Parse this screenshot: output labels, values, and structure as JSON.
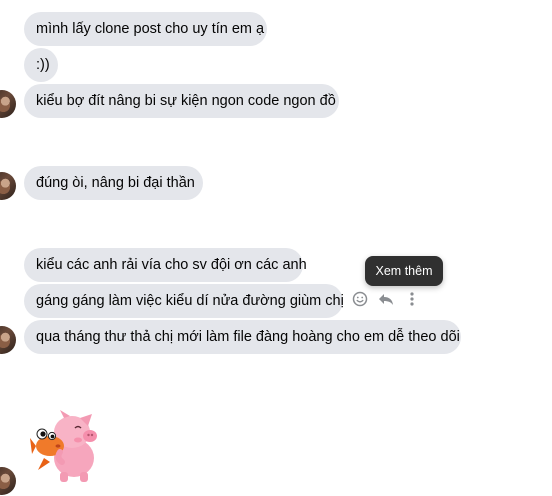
{
  "messages": [
    {
      "text": "mình lấy clone post cho uy tín em ạ"
    },
    {
      "text": ":))"
    },
    {
      "text": "kiểu bợ đít nâng bi sự kiện ngon code ngon đồ"
    },
    {
      "text": "đúng òi, nâng bi đại thần"
    },
    {
      "text": "kiểu các anh rải vía cho sv đội ơn các anh"
    },
    {
      "text": "gáng gáng làm việc kiểu dí nửa đường giùm chị"
    },
    {
      "text": "qua tháng thư thả chị mới làm file đàng hoàng cho em dễ theo dõi"
    }
  ],
  "tooltip": {
    "text": "Xem thêm"
  },
  "icons": {
    "react": "smiley-icon",
    "reply": "reply-icon",
    "more": "more-vertical-icon"
  },
  "colors": {
    "bubble_bg": "#e4e6eb",
    "text": "#050505",
    "tooltip_bg": "#303030",
    "icon": "#8a8d91"
  }
}
